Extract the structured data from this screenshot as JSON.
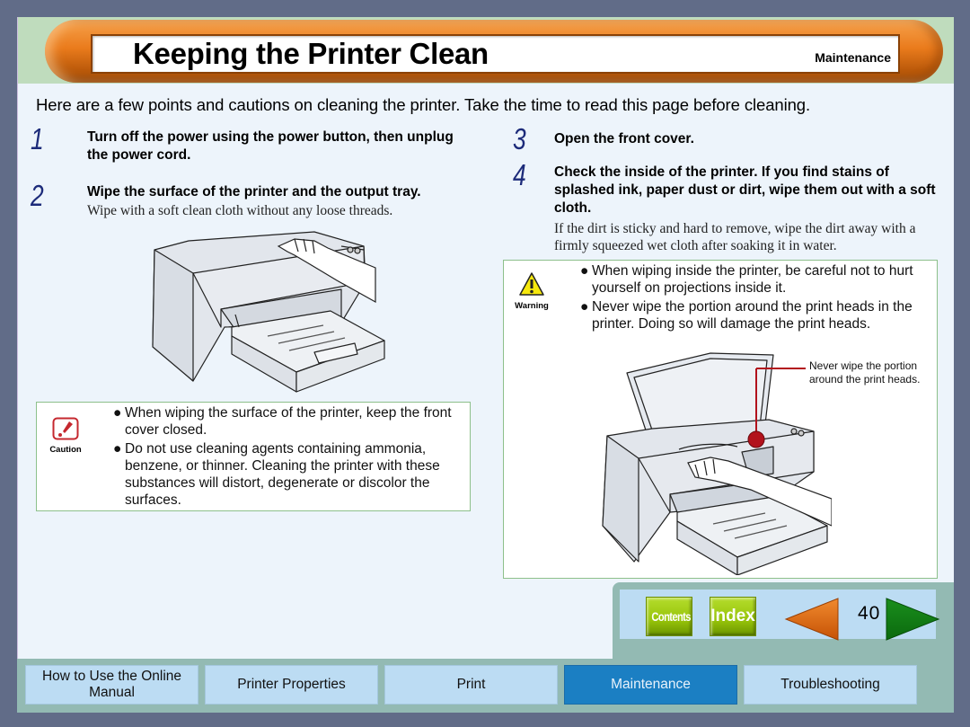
{
  "header": {
    "title": "Keeping the Printer Clean",
    "section": "Maintenance"
  },
  "intro": "Here are a few points and cautions on cleaning the printer. Take the time to read this page before cleaning.",
  "steps": [
    {
      "number": "1",
      "text": "Turn off the power using the power button, then unplug the power cord.",
      "sub": ""
    },
    {
      "number": "2",
      "text": "Wipe the surface of the printer and the output tray.",
      "sub": "Wipe with a soft clean cloth without any loose threads."
    },
    {
      "number": "3",
      "text": "Open the front cover.",
      "sub": ""
    },
    {
      "number": "4",
      "text": "Check the inside of the printer. If you find stains of splashed ink, paper dust or dirt, wipe them out with a soft cloth.",
      "sub": "If the dirt is sticky and hard to remove, wipe the dirt away with a firmly squeezed wet cloth after soaking it in water."
    }
  ],
  "caution": {
    "label": "Caution",
    "icon": "caution-icon",
    "items": [
      "When wiping the surface of the printer, keep the front cover closed.",
      "Do not use cleaning agents containing ammonia, benzene, or thinner. Cleaning the printer with these substances will distort, degenerate or discolor the surfaces."
    ]
  },
  "warning": {
    "label": "Warning",
    "icon": "warning-triangle-icon",
    "items": [
      "When wiping inside the printer, be careful not to hurt yourself on projections inside it.",
      "Never wipe the portion around the print heads in the printer. Doing so will damage the print heads."
    ]
  },
  "callout": "Never wipe the portion around the print heads.",
  "bullet": "●",
  "pagenav": {
    "contents_label": "Contents",
    "index_label": "Index",
    "page_number": "40",
    "prev_icon": "arrow-left-icon",
    "next_icon": "arrow-right-icon",
    "colors": {
      "prev": "#e06a12",
      "next": "#0f7a12",
      "button": "#97c40a"
    }
  },
  "bottom_nav": {
    "tabs": [
      {
        "label": "How to Use the Online Manual",
        "active": false
      },
      {
        "label": "Printer Properties",
        "active": false
      },
      {
        "label": "Print",
        "active": false
      },
      {
        "label": "Maintenance",
        "active": true
      },
      {
        "label": "Troubleshooting",
        "active": false
      }
    ],
    "active_color": "#1b7fc3"
  }
}
